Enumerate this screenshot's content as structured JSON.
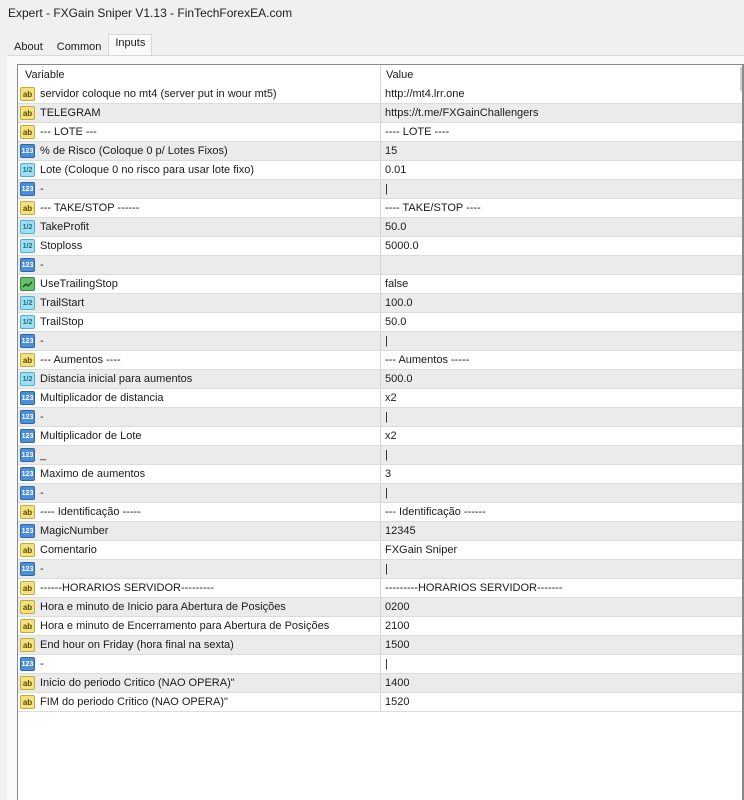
{
  "window": {
    "title": "Expert - FXGain Sniper V1.13 - FinTechForexEA.com"
  },
  "tabs": [
    {
      "label": "About",
      "active": false
    },
    {
      "label": "Common",
      "active": false
    },
    {
      "label": "Inputs",
      "active": true
    }
  ],
  "grid": {
    "columns": {
      "variable": "Variable",
      "value": "Value"
    },
    "rows": [
      {
        "type": "string",
        "icon": "ab",
        "variable": "servidor coloque no mt4 (server put in wour mt5)",
        "value": "http://mt4.lrr.one"
      },
      {
        "type": "string",
        "icon": "ab",
        "variable": "TELEGRAM",
        "value": "https://t.me/FXGainChallengers"
      },
      {
        "type": "string",
        "icon": "ab",
        "variable": "--- LOTE ---",
        "value": "---- LOTE ----"
      },
      {
        "type": "int",
        "icon": "123",
        "variable": "% de Risco  (Coloque 0 p/ Lotes Fixos)",
        "value": "15"
      },
      {
        "type": "double",
        "icon": "1/2",
        "variable": "Lote (Coloque 0 no risco para usar lote fixo)",
        "value": "0.01"
      },
      {
        "type": "int",
        "icon": "123",
        "variable": "-",
        "value": "|"
      },
      {
        "type": "string",
        "icon": "ab",
        "variable": "--- TAKE/STOP ------",
        "value": "---- TAKE/STOP ----"
      },
      {
        "type": "double",
        "icon": "1/2",
        "variable": "TakeProfit",
        "value": "50.0"
      },
      {
        "type": "double",
        "icon": "1/2",
        "variable": "Stoploss",
        "value": "5000.0"
      },
      {
        "type": "int",
        "icon": "123",
        "variable": "-",
        "value": ""
      },
      {
        "type": "bool",
        "icon": "bool",
        "variable": "UseTrailingStop",
        "value": "false"
      },
      {
        "type": "double",
        "icon": "1/2",
        "variable": "TrailStart",
        "value": "100.0"
      },
      {
        "type": "double",
        "icon": "1/2",
        "variable": "TrailStop",
        "value": "50.0"
      },
      {
        "type": "int",
        "icon": "123",
        "variable": "-",
        "value": "|"
      },
      {
        "type": "string",
        "icon": "ab",
        "variable": "--- Aumentos ----",
        "value": "--- Aumentos -----"
      },
      {
        "type": "double",
        "icon": "1/2",
        "variable": "Distancia inicial para aumentos",
        "value": "500.0"
      },
      {
        "type": "int",
        "icon": "123",
        "variable": "Multiplicador de distancia",
        "value": "x2"
      },
      {
        "type": "int",
        "icon": "123",
        "variable": "-",
        "value": "|"
      },
      {
        "type": "int",
        "icon": "123",
        "variable": "Multiplicador de Lote",
        "value": "x2"
      },
      {
        "type": "int",
        "icon": "123",
        "variable": "_",
        "value": "|"
      },
      {
        "type": "int",
        "icon": "123",
        "variable": "Maximo de aumentos",
        "value": "3"
      },
      {
        "type": "int",
        "icon": "123",
        "variable": "-",
        "value": "|"
      },
      {
        "type": "string",
        "icon": "ab",
        "variable": "---- Identificação -----",
        "value": "--- Identificação ------"
      },
      {
        "type": "int",
        "icon": "123",
        "variable": "MagicNumber",
        "value": "12345"
      },
      {
        "type": "string",
        "icon": "ab",
        "variable": "Comentario",
        "value": "FXGain Sniper"
      },
      {
        "type": "int",
        "icon": "123",
        "variable": "-",
        "value": "|"
      },
      {
        "type": "string",
        "icon": "ab",
        "variable": "------HORARIOS SERVIDOR---------",
        "value": "---------HORARIOS SERVIDOR-------"
      },
      {
        "type": "string",
        "icon": "ab",
        "variable": "Hora e minuto de Inicio para Abertura de Posições",
        "value": "0200"
      },
      {
        "type": "string",
        "icon": "ab",
        "variable": "Hora e minuto de Encerramento para Abertura de Posições",
        "value": "2100"
      },
      {
        "type": "string",
        "icon": "ab",
        "variable": "End hour on Friday (hora final na sexta)",
        "value": "1500"
      },
      {
        "type": "int",
        "icon": "123",
        "variable": "-",
        "value": "|"
      },
      {
        "type": "string",
        "icon": "ab",
        "variable": "Inicio do periodo Critico (NAO OPERA)\"",
        "value": "1400"
      },
      {
        "type": "string",
        "icon": "ab",
        "variable": "FIM do periodo Critico (NAO OPERA)\"",
        "value": "1520"
      }
    ]
  }
}
